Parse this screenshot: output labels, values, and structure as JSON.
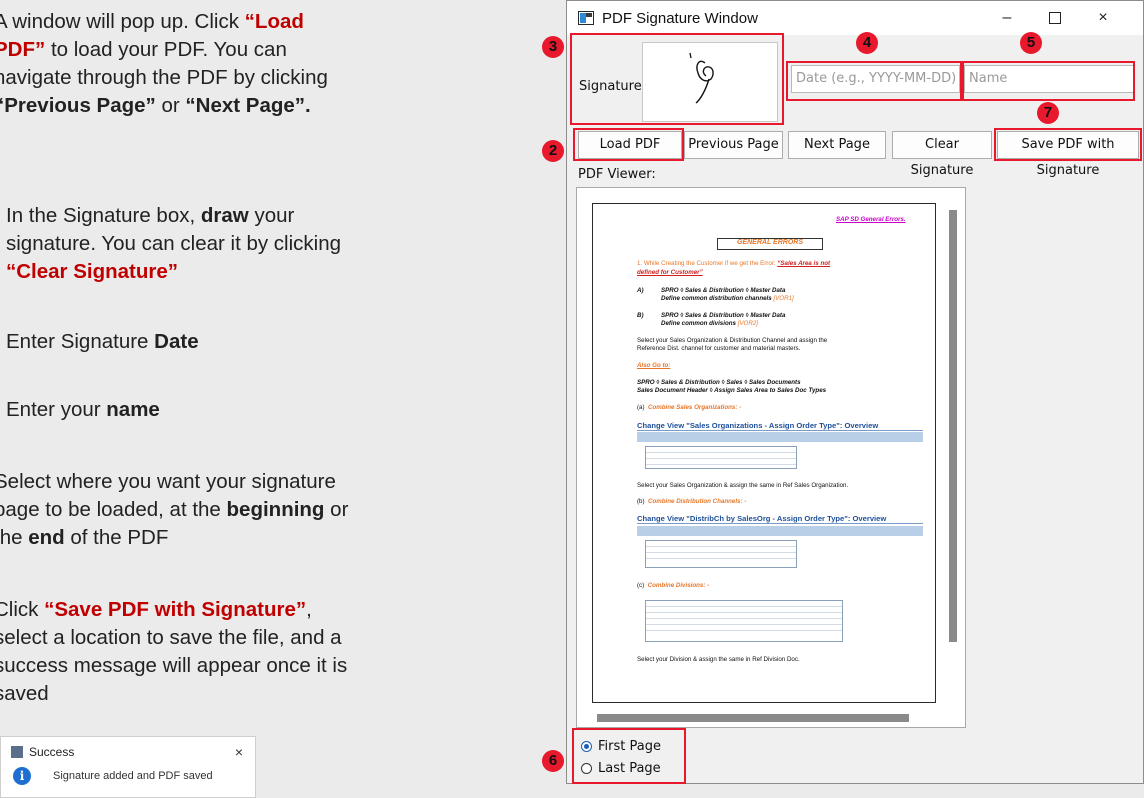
{
  "instructions": {
    "step2_a": "A window will pop up. Click ",
    "step2_b": "“Load",
    "step2_c": "PDF”",
    "step2_d": " to load your PDF. You can",
    "step2_e": "navigate through the PDF by clicking",
    "step2_f": "“Previous Page”",
    "step2_g": " or ",
    "step2_h": "“Next Page”.",
    "step3_a": "In the Signature box, ",
    "step3_b": "draw",
    "step3_c": " your",
    "step3_d": "signature. You can clear it by clicking",
    "step3_e": "“Clear Signature”",
    "step4_a": "Enter Signature ",
    "step4_b": "Date",
    "step5_a": "Enter your ",
    "step5_b": "name",
    "step6_a": "Select where you want your signature",
    "step6_b": "page to be loaded, at the ",
    "step6_c": "beginning",
    "step6_d": " or",
    "step6_e": "the ",
    "step6_f": "end",
    "step6_g": " of the PDF",
    "step7_a": "Click ",
    "step7_b": "“Save PDF with Signature”",
    "step7_c": ",",
    "step7_d": "select a location to save the file, and a",
    "step7_e": "success message will appear once it is",
    "step7_f": "saved"
  },
  "success_dialog": {
    "title": "Success",
    "close": "×",
    "info_icon": "i",
    "message": "Signature added and PDF saved"
  },
  "window": {
    "title": "PDF Signature Window",
    "minimize": "–",
    "close": "×",
    "signature_label": "Signature:",
    "date_placeholder": "Date (e.g., YYYY-MM-DD)",
    "name_placeholder": "Name",
    "buttons": {
      "load_pdf": "Load PDF",
      "previous_page": "Previous Page",
      "next_page": "Next Page",
      "clear_signature": "Clear Signature",
      "save_pdf": "Save PDF with Signature"
    },
    "viewer_label": "PDF Viewer:",
    "radios": {
      "first_page": "First Page",
      "last_page": "Last Page",
      "selected": "First Page"
    }
  },
  "pdf_page": {
    "header_link": "SAP SD General Errors.",
    "title": "GENERAL ERRORS",
    "point1_a": "1. While Creating the Customer if we get the Error:",
    "point1_b": "“Sales Area is not",
    "point1_c": "defined for Customer”",
    "a_label": "A)",
    "a_line1": "SPRO ◊  Sales & Distribution ◊ Master Data",
    "a_line2": "Define common distribution channels",
    "a_code": "[VOR1]",
    "b_label": "B)",
    "b_line1": "SPRO ◊  Sales & Distribution ◊ Master Data",
    "b_line2": "Define common divisions",
    "b_code": "[VOR2]",
    "select_text1": "Select your Sales Organization & Distribution Channel and assign the",
    "select_text2": "Reference Dist. channel for customer and material masters.",
    "also_go": "Also Go to:",
    "spro_line1": "SPRO ◊  Sales & Distribution ◊ Sales ◊  Sales Documents",
    "spro_line2": "Sales Document Header ◊  Assign Sales Area to Sales Doc Types",
    "a_item_num": "(a)",
    "a_item": "Combine Sales Organizations: -",
    "sap1_head": "Change View \"Sales Organizations - Assign Order Type\": Overview",
    "sap1_text": "Select your Sales Organization & assign the same in Ref Sales Organization.",
    "b_item_num": "(b)",
    "b_item": "Combine  Distribution Channels: -",
    "sap2_head": "Change View \"DistribCh by SalesOrg - Assign Order Type\": Overview",
    "c_item_num": "(c)",
    "c_item": "Combine  Divisions: -",
    "final_text": "Select your Division & assign the same in Ref Division Doc."
  },
  "markers": [
    "2",
    "3",
    "4",
    "5",
    "6",
    "7"
  ],
  "colors": {
    "highlight": "#e8192c",
    "instruction_red": "#c00000",
    "radio_blue": "#1a5fb4"
  }
}
